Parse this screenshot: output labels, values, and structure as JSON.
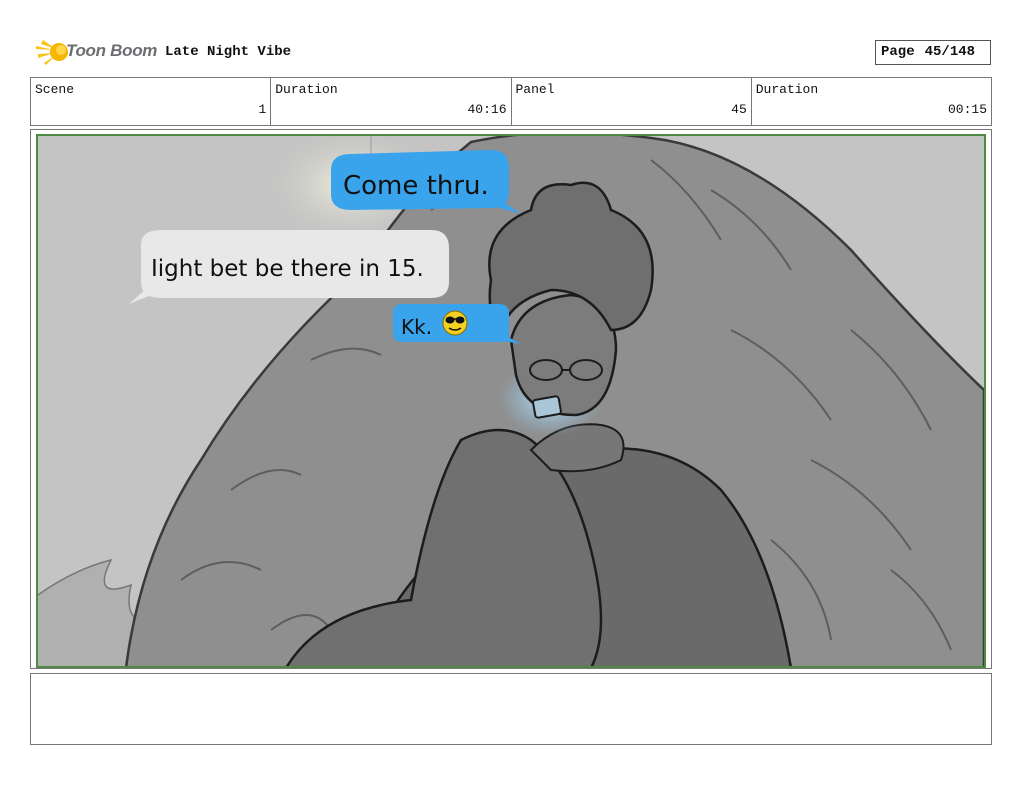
{
  "header": {
    "logo_text": "Toon Boom",
    "project_title": "Late Night Vibe",
    "page_label": "Page",
    "page_number": "45/148"
  },
  "info": {
    "scene_label": "Scene",
    "scene_value": "1",
    "scene_duration_label": "Duration",
    "scene_duration_value": "40:16",
    "panel_label": "Panel",
    "panel_value": "45",
    "panel_duration_label": "Duration",
    "panel_duration_value": "00:15"
  },
  "panel": {
    "bubbles": [
      {
        "text": "Come thru."
      },
      {
        "text": "Iight bet be there in 15."
      },
      {
        "text": "Kk."
      }
    ],
    "colors": {
      "blue_bubble": "#39a3ec",
      "grey_bubble": "#e8e8e8",
      "frame_green": "#4f8a45",
      "background": "#c4c4c4",
      "rock": "#8f8f8f"
    }
  },
  "notes": {
    "text": ""
  }
}
